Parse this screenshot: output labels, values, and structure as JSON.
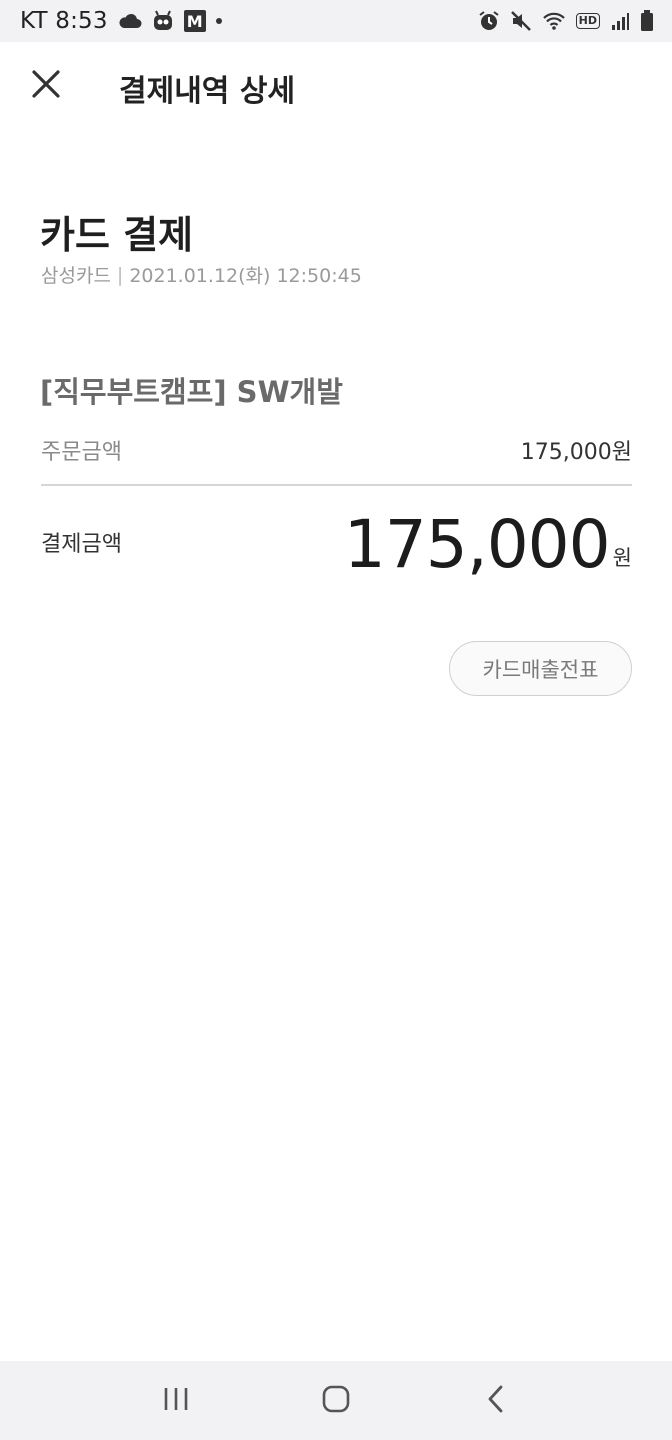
{
  "status_bar": {
    "carrier_time": "KT 8:53",
    "hd_label": "HD",
    "m_badge": "M"
  },
  "header": {
    "title": "결제내역 상세"
  },
  "payment": {
    "title": "카드 결제",
    "card_name": "삼성카드",
    "separator": "|",
    "datetime": "2021.01.12(화) 12:50:45"
  },
  "order": {
    "product_name": "[직무부트캠프] SW개발",
    "order_amount_label": "주문금액",
    "order_amount_value": "175,000원",
    "total_label": "결제금액",
    "total_amount": "175,000",
    "total_unit": "원"
  },
  "actions": {
    "receipt_button": "카드매출전표"
  },
  "icons": {
    "close": "close-icon",
    "recents": "recents-icon",
    "home": "home-icon",
    "back": "back-icon"
  }
}
